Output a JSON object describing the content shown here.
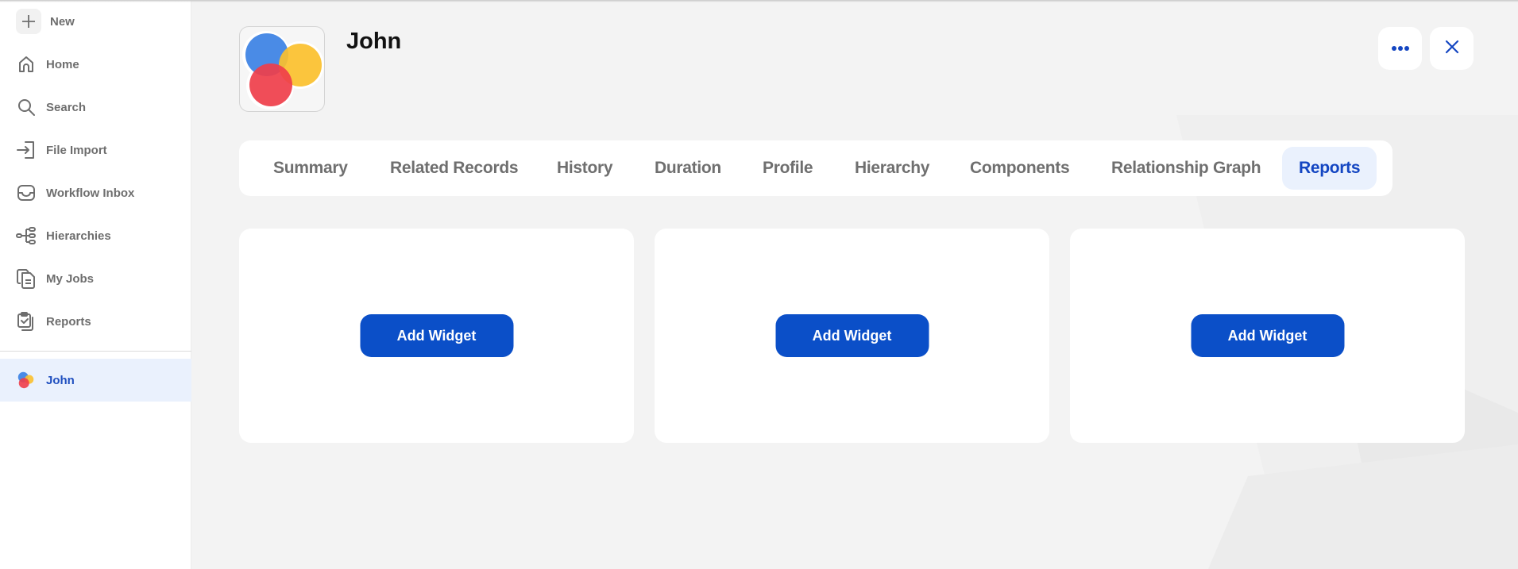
{
  "sidebar": {
    "new_label": "New",
    "items": [
      {
        "label": "Home",
        "icon": "home-icon"
      },
      {
        "label": "Search",
        "icon": "search-icon"
      },
      {
        "label": "File Import",
        "icon": "file-import-icon"
      },
      {
        "label": "Workflow Inbox",
        "icon": "inbox-icon"
      },
      {
        "label": "Hierarchies",
        "icon": "hierarchy-icon"
      },
      {
        "label": "My Jobs",
        "icon": "jobs-icon"
      },
      {
        "label": "Reports",
        "icon": "reports-icon"
      }
    ],
    "active_record": {
      "label": "John",
      "icon": "record-avatar-icon"
    }
  },
  "header": {
    "title": "John",
    "more_icon": "more-horizontal-icon",
    "close_icon": "close-icon"
  },
  "tabs": [
    {
      "label": "Summary",
      "active": false
    },
    {
      "label": "Related Records",
      "active": false
    },
    {
      "label": "History",
      "active": false
    },
    {
      "label": "Duration",
      "active": false
    },
    {
      "label": "Profile",
      "active": false
    },
    {
      "label": "Hierarchy",
      "active": false
    },
    {
      "label": "Components",
      "active": false
    },
    {
      "label": "Relationship Graph",
      "active": false
    },
    {
      "label": "Reports",
      "active": true
    }
  ],
  "widgets": [
    {
      "button_label": "Add Widget"
    },
    {
      "button_label": "Add Widget"
    },
    {
      "button_label": "Add Widget"
    }
  ],
  "colors": {
    "accent": "#0b4fc8",
    "active_tab_bg": "#eaf1fd",
    "avatar_blue": "#4a8be6",
    "avatar_yellow": "#fbc02d",
    "avatar_red": "#ef3e4a"
  }
}
